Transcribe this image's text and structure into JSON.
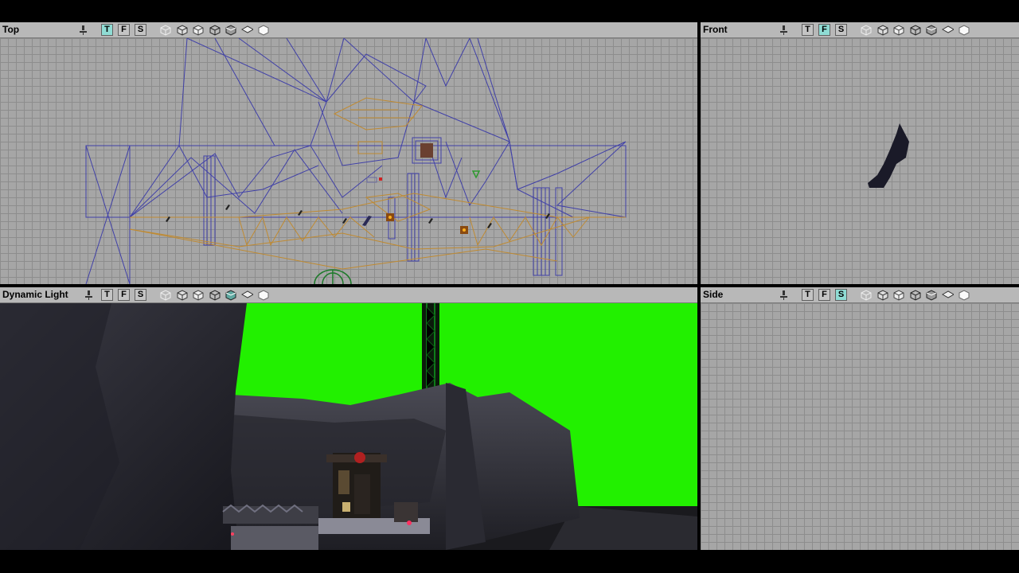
{
  "viewports": {
    "top": {
      "title": "Top",
      "active_mode": "T"
    },
    "front": {
      "title": "Front",
      "active_mode": "F"
    },
    "dynamic": {
      "title": "Dynamic Light"
    },
    "side": {
      "title": "Side",
      "active_mode": "S"
    }
  },
  "toolbar": {
    "mode_buttons": [
      "T",
      "F",
      "S"
    ],
    "icons": [
      "camera-icon",
      "wireframe-cube-icon",
      "zone-cube-icon",
      "brush-cube-icon",
      "textured-cube-icon",
      "lit-cube-icon",
      "flat-cube-icon",
      "solid-cube-icon"
    ]
  },
  "colors": {
    "grid_bg": "#a6a6a6",
    "sky": "#22f000",
    "wire_blue": "#4040a8",
    "wire_orange": "#c08a30",
    "active_button": "#8fdcd4"
  }
}
